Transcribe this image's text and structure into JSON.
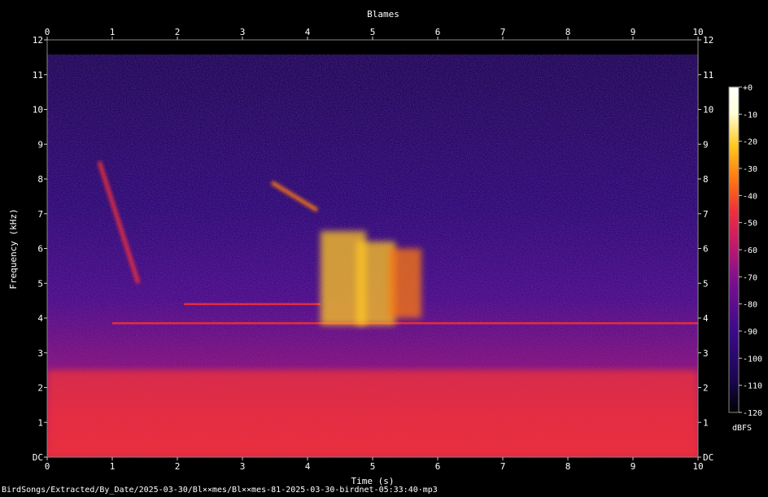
{
  "chart_data": {
    "type": "heatmap",
    "title": "Blames",
    "xlabel": "Time (s)",
    "ylabel": "Frequency (kHz)",
    "xlim": [
      0,
      10
    ],
    "ylim": [
      0,
      12
    ],
    "x_ticks": [
      "0",
      "1",
      "2",
      "3",
      "4",
      "5",
      "6",
      "7",
      "8",
      "9",
      "10"
    ],
    "y_ticks": [
      "DC",
      "1",
      "2",
      "3",
      "4",
      "5",
      "6",
      "7",
      "8",
      "9",
      "10",
      "11",
      "12"
    ],
    "colorbar": {
      "label": "dBFS",
      "ticks": [
        "+0",
        "-10",
        "-20",
        "-30",
        "-40",
        "-50",
        "-60",
        "-70",
        "-80",
        "-90",
        "-100",
        "-110",
        "-120"
      ],
      "range": [
        -120,
        0
      ],
      "colors": [
        "#000000",
        "#1a0650",
        "#3b0a8c",
        "#7a0f90",
        "#c41a6a",
        "#f0303a",
        "#ff7a10",
        "#ffc820",
        "#ffffd8",
        "#ffffff"
      ]
    },
    "grid": false,
    "features": [
      {
        "name": "low-frequency band",
        "t": [
          0,
          10
        ],
        "f": [
          0,
          2.5
        ],
        "level_db": -60
      },
      {
        "name": "tone 3.85 kHz",
        "t": [
          1.0,
          10.0
        ],
        "f": 3.85,
        "level_db": -55
      },
      {
        "name": "tone 4.4 kHz",
        "t": [
          2.1,
          4.2
        ],
        "f": 4.4,
        "level_db": -60
      },
      {
        "name": "burst",
        "t": [
          4.2,
          4.9
        ],
        "f": [
          3.8,
          6.5
        ],
        "level_db": -30
      },
      {
        "name": "burst",
        "t": [
          4.75,
          5.35
        ],
        "f": [
          3.8,
          6.2
        ],
        "level_db": -30
      },
      {
        "name": "burst",
        "t": [
          5.25,
          5.75
        ],
        "f": [
          4.0,
          6.0
        ],
        "level_db": -35
      },
      {
        "name": "sweep",
        "t": [
          3.45,
          4.15
        ],
        "f": [
          7.9,
          7.1
        ],
        "level_db": -35
      },
      {
        "name": "sweep",
        "t": [
          0.8,
          1.4
        ],
        "f": [
          8.5,
          5.0
        ],
        "level_db": -55
      }
    ]
  },
  "footer": {
    "file_path": "BirdSongs/Extracted/By_Date/2025-03-30/Bl××mes/Bl××mes-81-2025-03-30-birdnet-05:33:40·mp3"
  }
}
